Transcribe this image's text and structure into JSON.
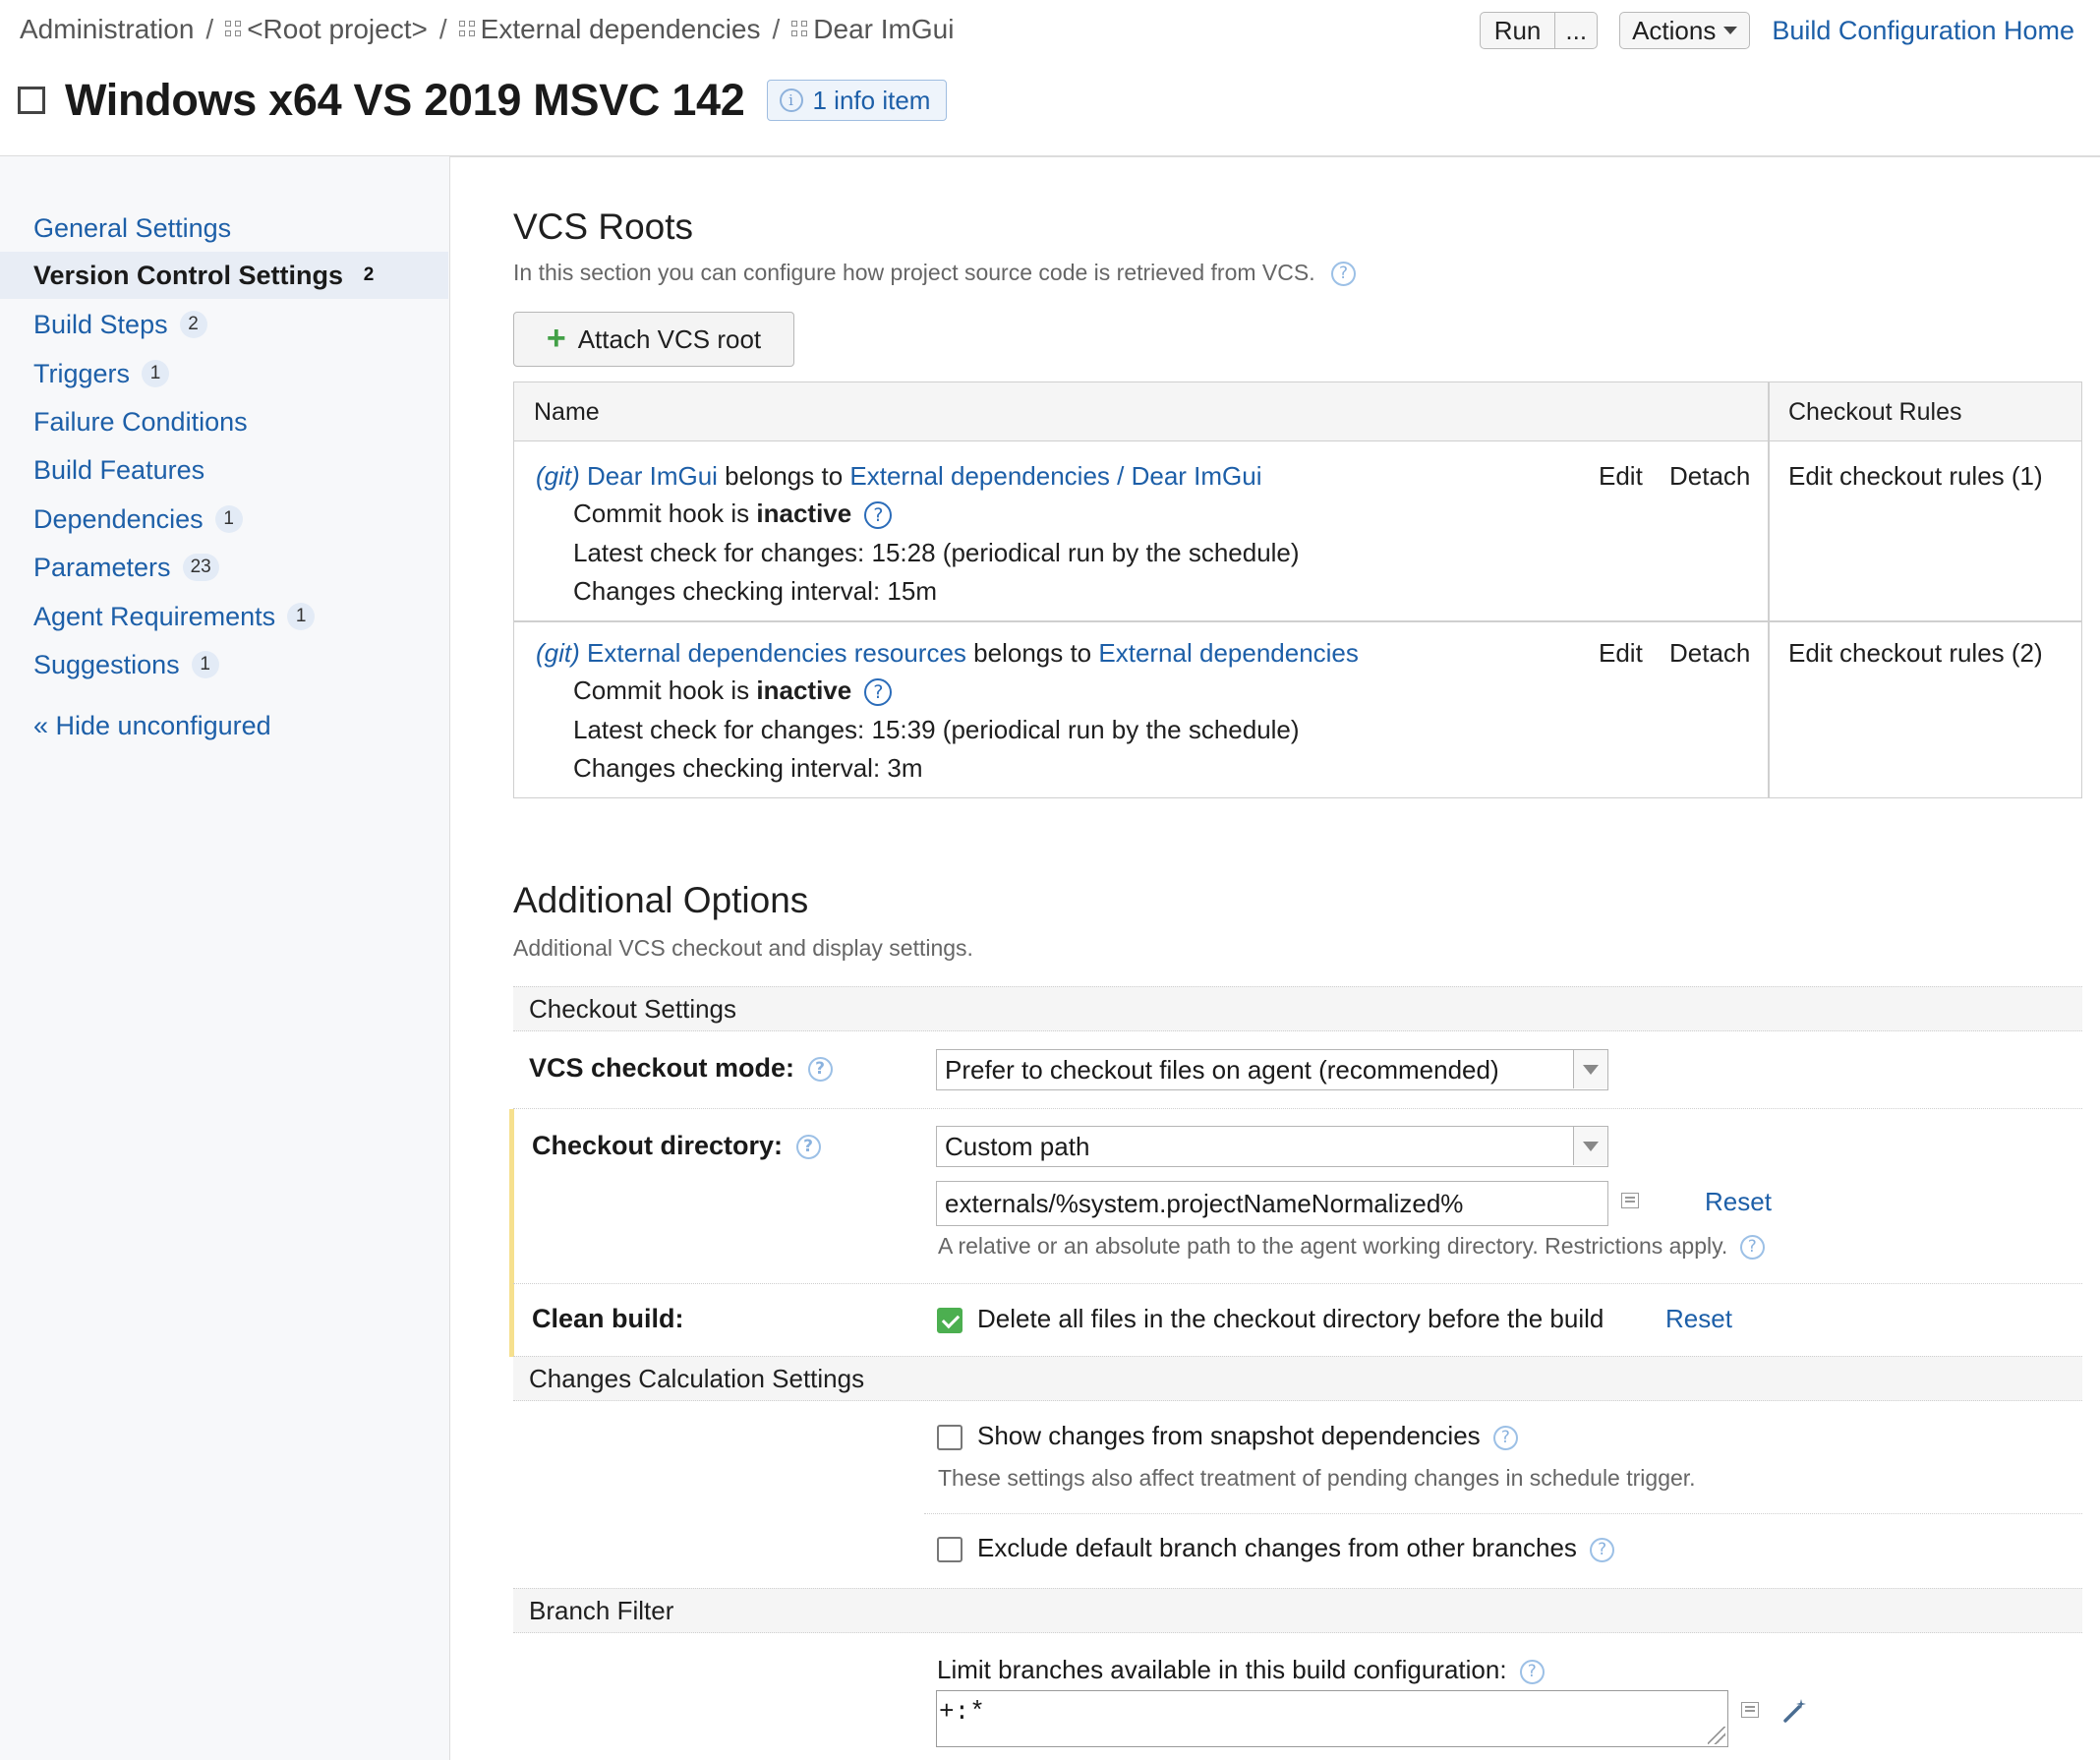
{
  "breadcrumb": {
    "items": [
      "Administration",
      "<Root project>",
      "External dependencies",
      "Dear ImGui"
    ],
    "separator": "/"
  },
  "header": {
    "run_label": "Run",
    "run_more_label": "...",
    "actions_label": "Actions",
    "home_link": "Build Configuration Home",
    "title": "Windows x64 VS 2019 MSVC 142",
    "info_badge": "1 info item"
  },
  "sidebar": {
    "items": [
      {
        "label": "General Settings",
        "count": ""
      },
      {
        "label": "Version Control Settings",
        "count": "2"
      },
      {
        "label": "Build Steps",
        "count": "2"
      },
      {
        "label": "Triggers",
        "count": "1"
      },
      {
        "label": "Failure Conditions",
        "count": ""
      },
      {
        "label": "Build Features",
        "count": ""
      },
      {
        "label": "Dependencies",
        "count": "1"
      },
      {
        "label": "Parameters",
        "count": "23"
      },
      {
        "label": "Agent Requirements",
        "count": "1"
      },
      {
        "label": "Suggestions",
        "count": "1"
      }
    ],
    "hide_link": "« Hide unconfigured"
  },
  "vcs": {
    "title": "VCS Roots",
    "subtitle": "In this section you can configure how project source code is retrieved from VCS.",
    "attach_label": "Attach VCS root",
    "col_name": "Name",
    "col_rules": "Checkout Rules",
    "belongs_to": "belongs to",
    "edit": "Edit",
    "detach": "Detach",
    "commit_hook_prefix": "Commit hook is",
    "rows": [
      {
        "type": "(git)",
        "name": "Dear ImGui",
        "owner": "External dependencies / Dear ImGui",
        "commit_hook": "inactive",
        "latest_check": "Latest check for changes: 15:28 (periodical run by the schedule)",
        "interval": "Changes checking interval: 15m",
        "rules": "Edit checkout rules (1)"
      },
      {
        "type": "(git)",
        "name": "External dependencies resources",
        "owner": "External dependencies",
        "commit_hook": "inactive",
        "latest_check": "Latest check for changes: 15:39 (periodical run by the schedule)",
        "interval": "Changes checking interval: 3m",
        "rules": "Edit checkout rules (2)"
      }
    ]
  },
  "options": {
    "title": "Additional Options",
    "subtitle": "Additional VCS checkout and display settings.",
    "checkout_section": "Checkout Settings",
    "checkout_mode_label": "VCS checkout mode:",
    "checkout_mode_value": "Prefer to checkout files on agent (recommended)",
    "checkout_dir_label": "Checkout directory:",
    "checkout_dir_mode": "Custom path",
    "checkout_dir_value": "externals/%system.projectNameNormalized%",
    "reset": "Reset",
    "checkout_dir_hint": "A relative or an absolute path to the agent working directory. Restrictions apply.",
    "clean_build_label": "Clean build:",
    "clean_build_text": "Delete all files in the checkout directory before the build",
    "clean_build_checked": true,
    "changes_section": "Changes Calculation Settings",
    "show_snapshot_label": "Show changes from snapshot dependencies",
    "show_snapshot_checked": false,
    "snapshot_hint": "These settings also affect treatment of pending changes in schedule trigger.",
    "exclude_default_label": "Exclude default branch changes from other branches",
    "exclude_default_checked": false,
    "branch_section": "Branch Filter",
    "branch_limit_label": "Limit branches available in this build configuration:",
    "branch_filter_value": "+:*"
  }
}
